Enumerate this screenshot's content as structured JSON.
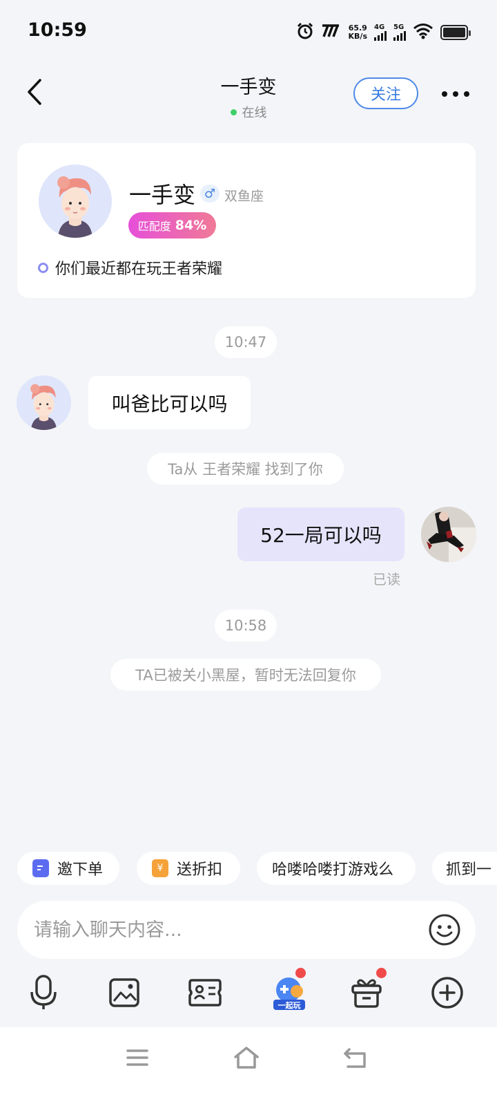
{
  "status_bar": {
    "time": "10:59",
    "net_speed_value": "65.9",
    "net_speed_unit": "KB/s",
    "sim1": "4G",
    "sim2": "5G",
    "icons": [
      "alarm-icon",
      "nfc-icon",
      "signal-icon",
      "wifi-icon",
      "battery-icon"
    ]
  },
  "header": {
    "back_icon": "chevron-left-icon",
    "title": "一手变",
    "online_status": "在线",
    "follow_label": "关注",
    "more_icon": "more-icon"
  },
  "profile": {
    "name": "一手变",
    "gender_symbol": "♂",
    "zodiac": "双鱼座",
    "match_label": "匹配度",
    "match_value": "84%",
    "common_game": "你们最近都在玩王者荣耀"
  },
  "messages": {
    "time_1": "10:47",
    "incoming_text": "叫爸比可以吗",
    "system_source": "Ta从 王者荣耀 找到了你",
    "outgoing_text": "52一局可以吗",
    "read_status": "已读",
    "time_2": "10:58",
    "system_blocked": "TA已被关小黑屋，暂时无法回复你"
  },
  "quick_replies": [
    {
      "label": "邀下单",
      "icon": "order-icon",
      "color": "#5b6cf0"
    },
    {
      "label": "送折扣",
      "icon": "coupon-icon",
      "color": "#f5a23a",
      "glyph": "¥"
    },
    {
      "label": "哈喽哈喽打游戏么"
    },
    {
      "label": "抓到一"
    }
  ],
  "input": {
    "placeholder": "请输入聊天内容...",
    "emoji_icon": "emoji-icon"
  },
  "toolbar": {
    "items": [
      "microphone-icon",
      "image-icon",
      "profile-card-icon",
      "play-together-icon",
      "gift-icon",
      "plus-icon"
    ],
    "play_together_label": "一起玩"
  },
  "colors": {
    "accent": "#3a7be0",
    "online": "#3fcf6a",
    "outgoing_bubble": "#e6e4fb",
    "background": "#f4f5f8",
    "badge_dot": "#f04a4a"
  }
}
